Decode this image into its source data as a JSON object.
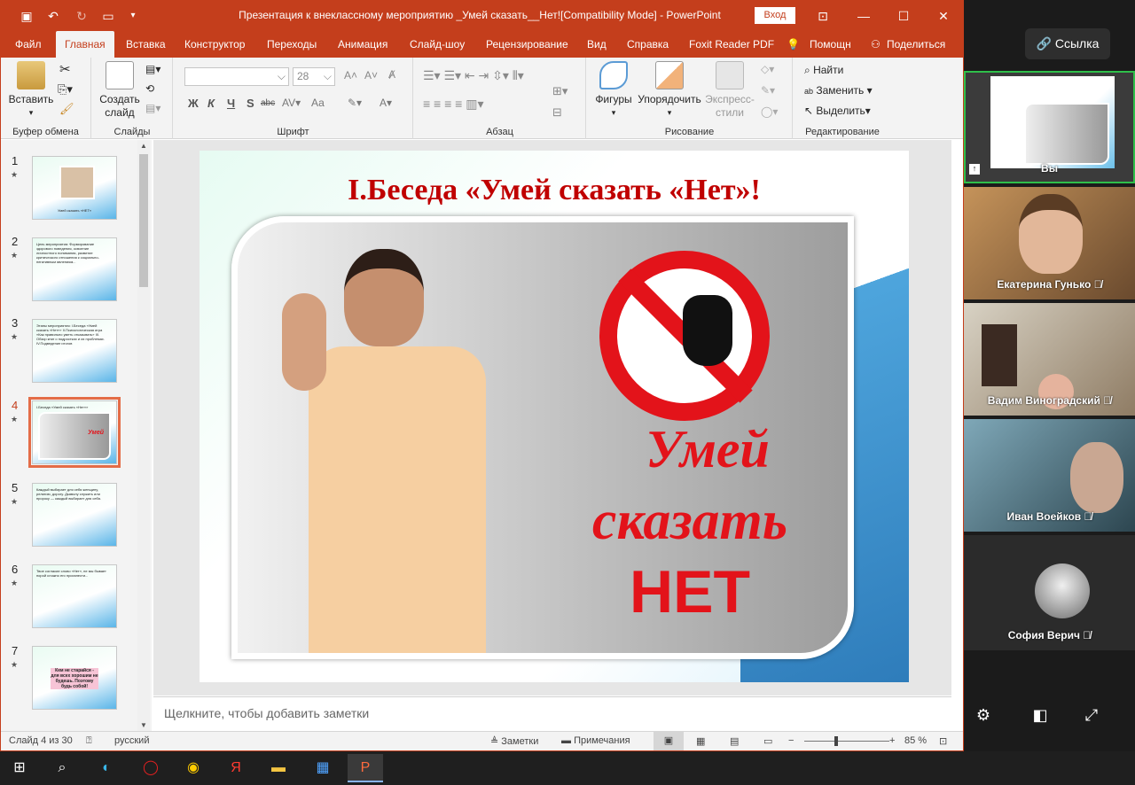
{
  "window": {
    "title": "Презентация к внеклассному мероприятию _Умей сказать__Нет![Compatibility Mode]  -  PowerPoint",
    "signin_label": "Вход"
  },
  "tabs": [
    "Файл",
    "Главная",
    "Вставка",
    "Конструктор",
    "Переходы",
    "Анимация",
    "Слайд-шоу",
    "Рецензирование",
    "Вид",
    "Справка",
    "Foxit Reader PDF"
  ],
  "help_label": "Помощн",
  "share_label": "Поделиться",
  "ribbon": {
    "paste": "Вставить",
    "clipboard_group": "Буфер обмена",
    "new_slide_1": "Создать",
    "new_slide_2": "слайд",
    "slides_group": "Слайды",
    "font_size": "28",
    "font_group": "Шрифт",
    "paragraph_group": "Абзац",
    "shapes": "Фигуры",
    "arrange": "Упорядочить",
    "quick_styles_1": "Экспресс-",
    "quick_styles_2": "стили",
    "drawing_group": "Рисование",
    "find": "Найти",
    "replace": "Заменить",
    "select": "Выделить",
    "editing_group": "Редактирование",
    "font_bold": "Ж",
    "font_italic": "К",
    "font_underline": "Ч",
    "font_shadow": "S",
    "font_strike": "abc",
    "font_case": "Аа"
  },
  "thumbnails": [
    {
      "num": "1",
      "text": "Умей сказать «НЕТ»"
    },
    {
      "num": "2",
      "text": "Цель мероприятия: Формирование здорового поведения, освоение личностного понимания, развитие критического отношения к социально-негативным явлениям..."
    },
    {
      "num": "3",
      "text": "Этапы мероприятия: I.Беседа «Умей сказать «Нет»» II.Психологическая игра «Как правильно уметь отказывать» III. Обзор книг о подростках и их проблемах. IV.Подведение итогов"
    },
    {
      "num": "4",
      "text": "I.Беседа «Умей сказать «Нет»»"
    },
    {
      "num": "5",
      "text": "Каждый выбирает для себя женщину, религию, дорогу. Дьяволу служить или пророку — каждый выбирает для себя."
    },
    {
      "num": "6",
      "text": "Твое согласие слово «Нет», не мы бывает порой сложно его произнести..."
    },
    {
      "num": "7",
      "text": "Кем не старайся - для всех хорошим не будешь. Поэтому будь собой!"
    }
  ],
  "slide": {
    "title": "I.Беседа «Умей сказать «Нет»!",
    "line1": "Умей",
    "line2": "сказать",
    "line3": "НЕТ"
  },
  "notes_placeholder": "Щелкните, чтобы добавить заметки",
  "status": {
    "slide_info": "Слайд 4 из 30",
    "language": "русский",
    "notes": "Заметки",
    "comments": "Примечания",
    "zoom": "85 %"
  },
  "zoom_app": {
    "link_label": "Ссылка",
    "participants": [
      {
        "name": "Вы"
      },
      {
        "name": "Екатерина Гунько"
      },
      {
        "name": "Вадим Виноградский"
      },
      {
        "name": "Иван Воейков"
      },
      {
        "name": "София Верич"
      }
    ]
  }
}
